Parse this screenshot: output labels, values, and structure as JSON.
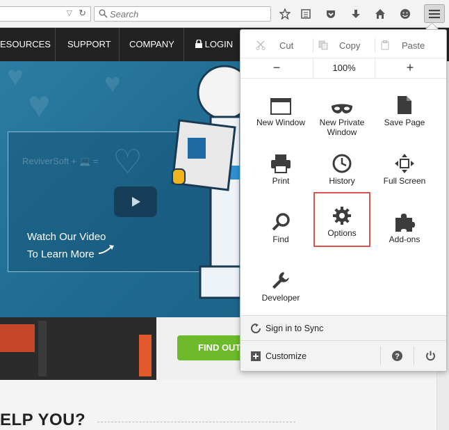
{
  "browser": {
    "search_placeholder": "Search",
    "icons": [
      "url-dropdown-icon",
      "reload-icon",
      "search-icon",
      "star-icon",
      "reading-list-icon",
      "pocket-icon",
      "download-icon",
      "home-icon",
      "emoji-icon",
      "hamburger-menu-icon"
    ]
  },
  "site": {
    "nav": [
      "ESOURCES",
      "SUPPORT",
      "COMPANY",
      "LOGIN"
    ],
    "video_brand": "ReviverSoft + 💻 =",
    "video_line1": "Watch Our Video",
    "video_line2": "To Learn More",
    "find_out": "FIND OUT",
    "help_heading": "ELP YOU?"
  },
  "menu": {
    "edit": {
      "cut": "Cut",
      "copy": "Copy",
      "paste": "Paste"
    },
    "zoom": {
      "minus": "−",
      "value": "100%",
      "plus": "+"
    },
    "items": [
      {
        "label": "New Window",
        "icon": "new-window-icon"
      },
      {
        "label": "New Private Window",
        "icon": "private-mask-icon"
      },
      {
        "label": "Save Page",
        "icon": "save-page-icon"
      },
      {
        "label": "Print",
        "icon": "printer-icon"
      },
      {
        "label": "History",
        "icon": "clock-icon"
      },
      {
        "label": "Full Screen",
        "icon": "fullscreen-icon"
      },
      {
        "label": "Find",
        "icon": "magnifier-icon"
      },
      {
        "label": "Options",
        "icon": "gear-icon",
        "selected": true
      },
      {
        "label": "Add-ons",
        "icon": "puzzle-icon"
      },
      {
        "label": "Developer",
        "icon": "wrench-icon"
      }
    ],
    "sync": "Sign in to Sync",
    "customize": "Customize"
  },
  "colors": {
    "highlight": "#d9534f",
    "nav_bg": "#222222",
    "hero_bg": "#1f6a90",
    "cta_green": "#6dbb2b"
  }
}
